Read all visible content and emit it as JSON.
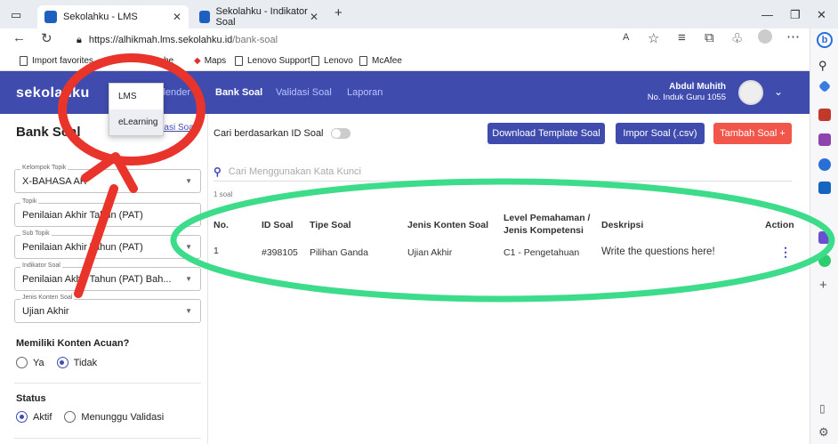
{
  "browser": {
    "tabs": [
      {
        "label": "Sekolahku - LMS"
      },
      {
        "label": "Sekolahku - Indikator Soal"
      }
    ],
    "new_tab": "+",
    "url_host": "https://alhikmah.lms.sekolahku.id",
    "url_path": "/bank-soal",
    "favorites": [
      {
        "label": "Import favorites"
      },
      {
        "label": "be"
      },
      {
        "label": "Maps"
      },
      {
        "label": "Lenovo Support"
      },
      {
        "label": "Lenovo"
      },
      {
        "label": "McAfee"
      }
    ]
  },
  "app": {
    "logo": "sekolahku",
    "nav": [
      {
        "label": "Kalender"
      },
      {
        "label": "Bank Soal"
      },
      {
        "label": "Validasi Soal"
      },
      {
        "label": "Laporan"
      }
    ],
    "user_name": "Abdul Muhith",
    "user_id": "No. Induk Guru 1055",
    "dropdown": [
      {
        "label": "LMS"
      },
      {
        "label": "eLearning"
      }
    ]
  },
  "left": {
    "title": "Bank Soal",
    "validasi_link": "Validasi Soal",
    "fields": [
      {
        "label": "Kelompok Topik",
        "value": "X-BAHASA AR"
      },
      {
        "label": "Topik",
        "value": "Penilaian Akhir Tahun (PAT)"
      },
      {
        "label": "Sub Topik",
        "value": "Penilaian Akhir Tahun (PAT)"
      },
      {
        "label": "Indikator Soal",
        "value": "Penilaian Akhir Tahun (PAT) Bah..."
      },
      {
        "label": "Jenis Konten Soal",
        "value": "Ujian Akhir"
      }
    ],
    "konten_acuan_title": "Memiliki Konten Acuan?",
    "konten_acuan_options": [
      "Ya",
      "Tidak"
    ],
    "status_title": "Status",
    "status_options": [
      "Aktif",
      "Menunggu Validasi"
    ]
  },
  "main": {
    "id_search_label": "Cari berdasarkan ID Soal",
    "buttons": {
      "download": "Download Template Soal",
      "import": "Impor Soal (.csv)",
      "add": "Tambah Soal +"
    },
    "search_placeholder": "Cari Menggunakan Kata Kunci",
    "small_text": "1 soal",
    "table": {
      "headers": [
        "No.",
        "ID Soal",
        "Tipe Soal",
        "Jenis Konten Soal",
        "Level Pemahaman / Jenis Kompetensi",
        "Deskripsi",
        "Action"
      ],
      "rows": [
        [
          "1",
          "#398105",
          "Pilihan Ganda",
          "Ujian Akhir",
          "C1 - Pengetahuan",
          "Write the questions here!"
        ]
      ]
    }
  },
  "colors": {
    "brand": "#3f4cae",
    "danger": "#f2564a",
    "annotation_red": "#e8342a",
    "annotation_green": "#3ddc8a"
  }
}
